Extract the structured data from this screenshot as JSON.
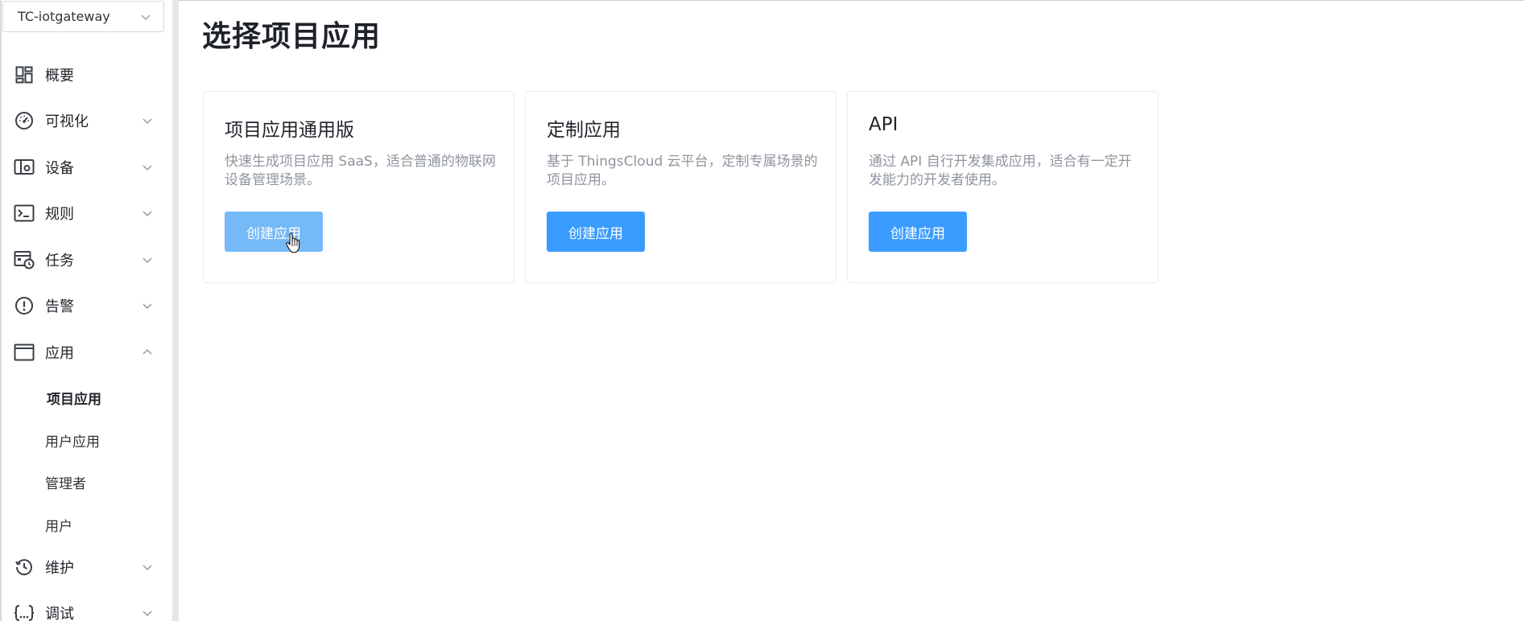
{
  "sidebar": {
    "project_select": {
      "value": "TC-iotgateway",
      "icon": "chevron-down-icon"
    },
    "menu": [
      {
        "label": "概要",
        "icon": "dashboard-grid-icon",
        "expandable": false
      },
      {
        "label": "可视化",
        "icon": "gauge-icon",
        "expandable": true,
        "expanded": false
      },
      {
        "label": "设备",
        "icon": "device-icon",
        "expandable": true,
        "expanded": false
      },
      {
        "label": "规则",
        "icon": "terminal-icon",
        "expandable": true,
        "expanded": false
      },
      {
        "label": "任务",
        "icon": "calendar-clock-icon",
        "expandable": true,
        "expanded": false
      },
      {
        "label": "告警",
        "icon": "alert-circle-icon",
        "expandable": true,
        "expanded": false
      },
      {
        "label": "应用",
        "icon": "window-icon",
        "expandable": true,
        "expanded": true
      },
      {
        "label": "维护",
        "icon": "history-clock-icon",
        "expandable": true,
        "expanded": false
      },
      {
        "label": "调试",
        "icon": "code-braces-icon",
        "expandable": true,
        "expanded": false
      }
    ],
    "app_submenu": [
      {
        "label": "项目应用",
        "active": true
      },
      {
        "label": "用户应用",
        "active": false
      },
      {
        "label": "管理者",
        "active": false
      },
      {
        "label": "用户",
        "active": false
      }
    ]
  },
  "main": {
    "title": "选择项目应用",
    "cards": [
      {
        "title": "项目应用通用版",
        "description": "快速生成项目应用 SaaS，适合普通的物联网设备管理场景。",
        "button_label": "创建应用",
        "hovered": true
      },
      {
        "title": "定制应用",
        "description": "基于 ThingsCloud 云平台，定制专属场景的项目应用。",
        "button_label": "创建应用",
        "hovered": false
      },
      {
        "title": "API",
        "description": "通过 API 自行开发集成应用，适合有一定开发能力的开发者使用。",
        "button_label": "创建应用",
        "hovered": false
      }
    ]
  },
  "colors": {
    "primary_button": "#3b9cff",
    "primary_button_hover": "#76b9f7",
    "description_text": "#8f959e",
    "sidebar_divider": "#e6e6e6"
  }
}
